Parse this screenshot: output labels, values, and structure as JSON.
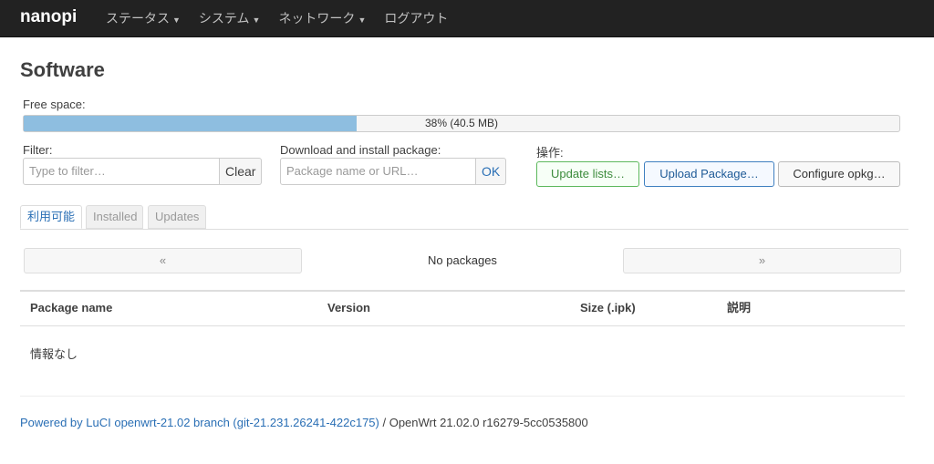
{
  "header": {
    "brand": "nanopi",
    "menu": [
      {
        "label": "ステータス",
        "has_dropdown": true
      },
      {
        "label": "システム",
        "has_dropdown": true
      },
      {
        "label": "ネットワーク",
        "has_dropdown": true
      },
      {
        "label": "ログアウト",
        "has_dropdown": false
      }
    ]
  },
  "page": {
    "title": "Software",
    "free_space_label": "Free space:",
    "free_space_percent": 38,
    "free_space_text": "38% (40.5 MB)"
  },
  "filter": {
    "label": "Filter:",
    "placeholder": "Type to filter…",
    "clear_label": "Clear"
  },
  "download": {
    "label": "Download and install package:",
    "placeholder": "Package name or URL…",
    "ok_label": "OK"
  },
  "actions": {
    "label": "操作:",
    "update_lists": "Update lists…",
    "upload_package": "Upload Package…",
    "configure_opkg": "Configure opkg…"
  },
  "tabs": [
    {
      "label": "利用可能",
      "active": true
    },
    {
      "label": "Installed",
      "active": false
    },
    {
      "label": "Updates",
      "active": false
    }
  ],
  "pager": {
    "prev": "«",
    "next": "»",
    "status": "No packages"
  },
  "table": {
    "columns": [
      "Package name",
      "Version",
      "Size (.ipk)",
      "説明"
    ],
    "empty_text": "情報なし"
  },
  "footer": {
    "link_text": "Powered by LuCI openwrt-21.02 branch (git-21.231.26241-422c175)",
    "rest_text": " / OpenWrt 21.02.0 r16279-5cc0535800"
  },
  "colors": {
    "navbar": "#222222",
    "progress_fill": "#8ebee0",
    "link": "#2a6fb5",
    "update_button_border": "#5cb85c",
    "upload_button_border": "#3f7fc0"
  }
}
